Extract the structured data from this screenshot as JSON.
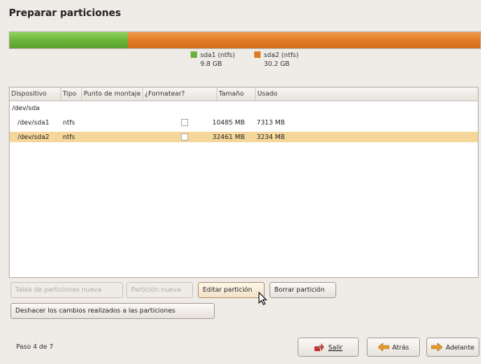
{
  "title": "Preparar particiones",
  "partition_bar": {
    "segments": [
      {
        "name": "sda1 (ntfs)",
        "size": "9.8 GB",
        "color": "#6ab33b"
      },
      {
        "name": "sda2 (ntfs)",
        "size": "30.2 GB",
        "color": "#e07b25"
      }
    ]
  },
  "table": {
    "columns": [
      "Dispositivo",
      "Tipo",
      "Punto de montaje",
      "¿Formatear?",
      "Tamaño",
      "Usado"
    ],
    "rows": [
      {
        "device": "/dev/sda",
        "type": "",
        "mount": "",
        "size": "",
        "used": ""
      },
      {
        "device": "/dev/sda1",
        "type": "ntfs",
        "mount": "",
        "size": "10485 MB",
        "used": "7313 MB"
      },
      {
        "device": "/dev/sda2",
        "type": "ntfs",
        "mount": "",
        "size": "32461 MB",
        "used": "3234 MB"
      }
    ]
  },
  "buttons": {
    "new_table": "Tabla de particiones nueva",
    "new_partition": "Partición nueva",
    "edit_partition": "Editar partición",
    "delete_partition": "Borrar partición",
    "undo": "Deshacer los cambios realizados a las particiones"
  },
  "footer": {
    "step": "Paso 4 de 7",
    "quit": "Salir",
    "back": "Atrás",
    "forward": "Adelante"
  },
  "colors": {
    "accent_selected_row": "#f6d79b",
    "green": "#6ab33b",
    "orange": "#e07b25"
  }
}
